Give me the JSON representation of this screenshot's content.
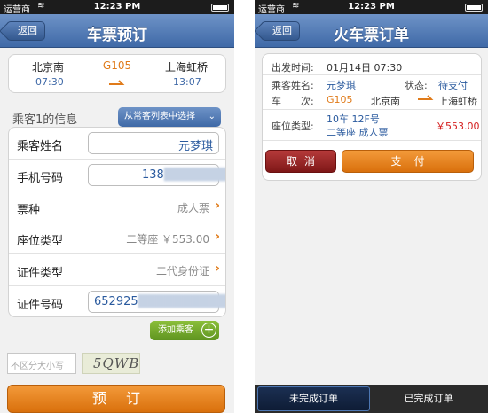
{
  "status_bar": {
    "carrier": "运营商",
    "time": "12:23 PM"
  },
  "booking_screen": {
    "back_label": "返回",
    "title": "车票预订",
    "trip": {
      "from_station": "北京南",
      "from_time": "07:30",
      "train_no": "G105",
      "to_station": "上海虹桥",
      "to_time": "13:07"
    },
    "passenger_section_label": "乘客1的信息",
    "select_from_list_label": "从常客列表中选择",
    "form": {
      "name_label": "乘客姓名",
      "name_value": "元梦琪",
      "phone_label": "手机号码",
      "phone_value_visible": "138",
      "ticket_type_label": "票种",
      "ticket_type_value": "成人票",
      "seat_type_label": "座位类型",
      "seat_type_value": "二等座 ￥553.00",
      "id_type_label": "证件类型",
      "id_type_value": "二代身份证",
      "id_number_label": "证件号码",
      "id_number_value_visible": "652925"
    },
    "add_passenger_label": "添加乘客",
    "captcha_placeholder": "不区分大小写",
    "captcha_text": "5QWB",
    "submit_label": "预订"
  },
  "order_screen": {
    "back_label": "返回",
    "title": "火车票订单",
    "departure_label": "出发时间:",
    "departure_value": "01月14日 07:30",
    "passenger_label": "乘客姓名:",
    "passenger_value": "元梦琪",
    "status_label": "状态:",
    "status_value": "待支付",
    "train_label": "车　　次:",
    "train_no": "G105",
    "from_station": "北京南",
    "to_station": "上海虹桥",
    "seat_label": "座位类型:",
    "seat_line1": "10车 12F号",
    "seat_line2": "二等座 成人票",
    "price": "￥553.00",
    "cancel_label": "取消",
    "pay_label": "支付",
    "tabs": [
      {
        "label": "未完成订单",
        "active": true
      },
      {
        "label": "已完成订单",
        "active": false
      }
    ]
  },
  "colors": {
    "nav_blue": "#3f69a7",
    "accent_orange": "#e07b1a",
    "price_red": "#d52020",
    "add_green": "#6fa52a"
  }
}
